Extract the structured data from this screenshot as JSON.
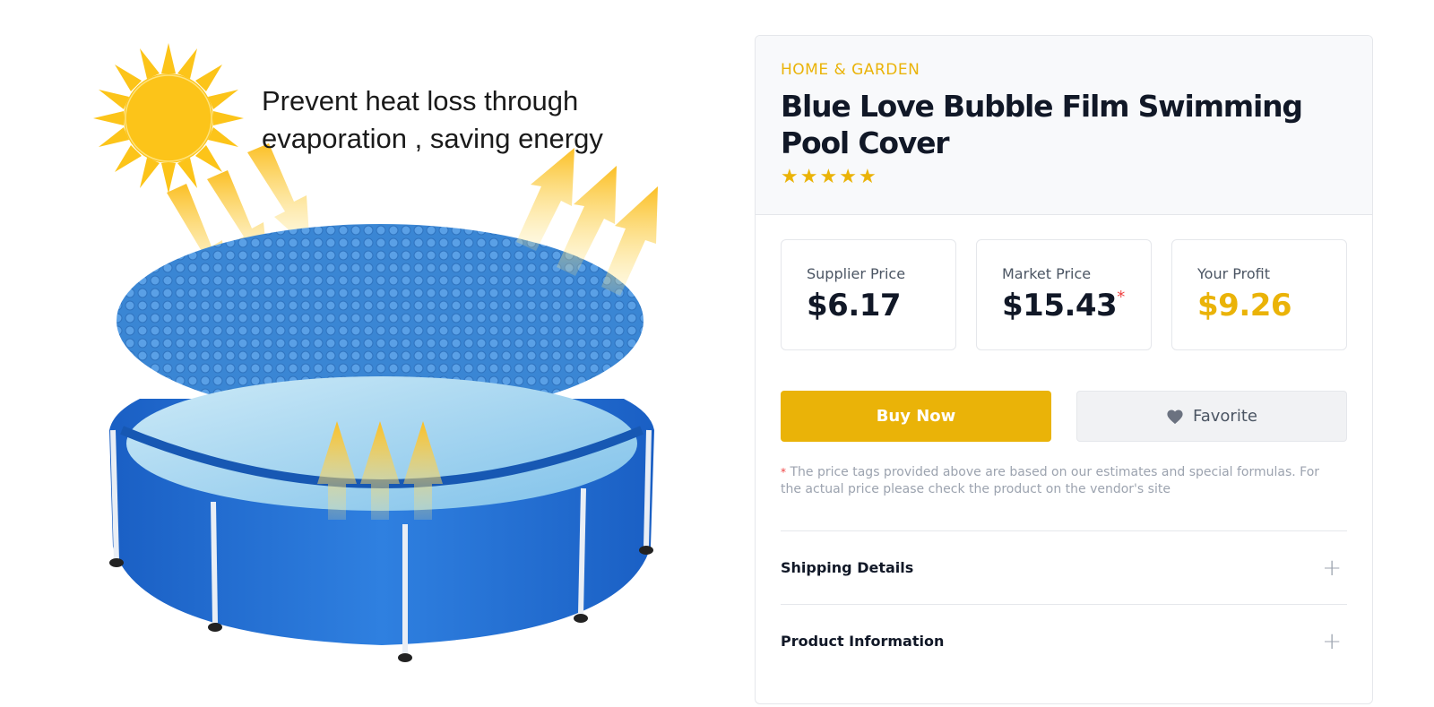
{
  "image": {
    "caption_line1": "Prevent heat loss through",
    "caption_line2": "evaporation , saving energy",
    "colors": {
      "sun": "#fcc419",
      "arrow": "#fbbf24",
      "pool_blue": "#1d6fd6",
      "water": "#9fd4f2"
    }
  },
  "product": {
    "category": "HOME & GARDEN",
    "title": "Blue Love Bubble Film Swimming Pool Cover",
    "rating": 5,
    "stars": [
      "★",
      "★",
      "★",
      "★",
      "★"
    ]
  },
  "prices": [
    {
      "label": "Supplier Price",
      "value": "$6.17",
      "marked": false
    },
    {
      "label": "Market Price",
      "value": "$15.43",
      "marked": true
    },
    {
      "label": "Your Profit",
      "value": "$9.26",
      "marked": false
    }
  ],
  "asterisk": "*",
  "buttons": {
    "buy": "Buy Now",
    "favorite": "Favorite"
  },
  "disclaimer": "The price tags provided above are based on our estimates and special formulas. For the actual price please check the product on the vendor's site",
  "accordion": [
    {
      "label": "Shipping Details",
      "icon": "+"
    },
    {
      "label": "Product Information",
      "icon": "+"
    }
  ],
  "colors": {
    "accent": "#eab308",
    "asterisk": "#ef4444",
    "text": "#111827",
    "muted": "#9ca3af"
  }
}
